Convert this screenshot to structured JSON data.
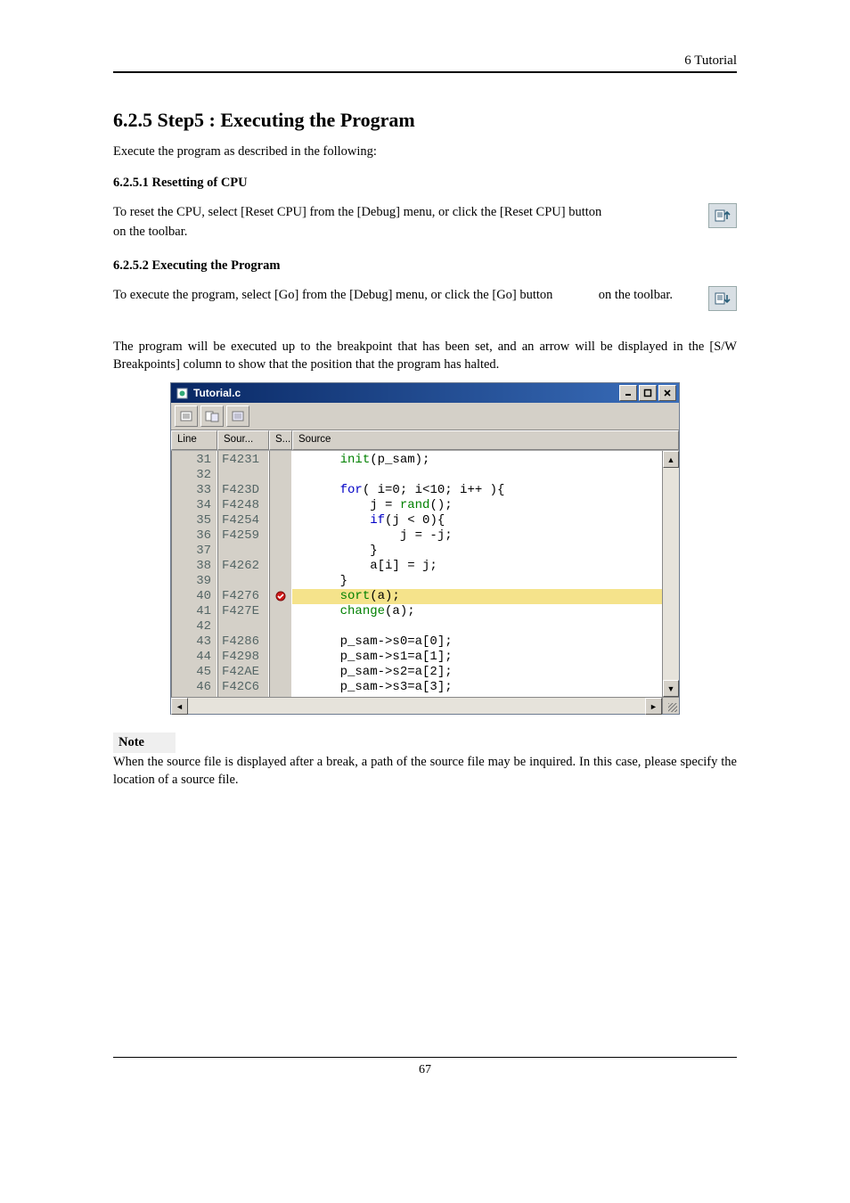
{
  "header": {
    "right": "6 Tutorial"
  },
  "section": {
    "title": "6.2.5 Step5 : Executing the Program"
  },
  "intro": "Execute the program as described in the following:",
  "sub1": {
    "title": "6.2.5.1 Resetting of CPU"
  },
  "reset_para_a": "To reset the CPU, select [Reset CPU] from the [Debug] menu, or click the [Reset CPU] button",
  "reset_para_b": "on the toolbar.",
  "sub2": {
    "title": "6.2.5.2 Executing the Program"
  },
  "exec_para_a": "To execute the program, select [Go] from the [Debug] menu, or click the [Go] button",
  "exec_para_b": "on the toolbar.",
  "exec_para2": "The program will be executed up to the breakpoint that has been set, and an arrow will be displayed in the [S/W Breakpoints] column to show that the position that the program has halted.",
  "codewin": {
    "title": "Tutorial.c",
    "cols": {
      "line": "Line",
      "sour": "Sour...",
      "bp": "S...",
      "src": "Source"
    },
    "rows": [
      {
        "line": "31",
        "addr": "F4231",
        "bp": "",
        "src": [
          [
            "    "
          ],
          [
            "green",
            "init"
          ],
          [
            "",
            "(p_sam);"
          ]
        ]
      },
      {
        "line": "32",
        "addr": "",
        "bp": "",
        "src": [
          [
            "",
            ""
          ]
        ]
      },
      {
        "line": "33",
        "addr": "F423D",
        "bp": "",
        "src": [
          [
            "    "
          ],
          [
            "blue",
            "for"
          ],
          [
            "",
            "( i=0; i<10; i++ ){"
          ]
        ]
      },
      {
        "line": "34",
        "addr": "F4248",
        "bp": "",
        "src": [
          [
            "        j = "
          ],
          [
            "green",
            "rand"
          ],
          [
            "",
            "();"
          ]
        ]
      },
      {
        "line": "35",
        "addr": "F4254",
        "bp": "",
        "src": [
          [
            "        "
          ],
          [
            "blue",
            "if"
          ],
          [
            "",
            "(j < 0){"
          ]
        ]
      },
      {
        "line": "36",
        "addr": "F4259",
        "bp": "",
        "src": [
          [
            "            j = -j;"
          ]
        ]
      },
      {
        "line": "37",
        "addr": "",
        "bp": "",
        "src": [
          [
            "        }"
          ]
        ]
      },
      {
        "line": "38",
        "addr": "F4262",
        "bp": "",
        "src": [
          [
            "        a[i] = j;"
          ]
        ]
      },
      {
        "line": "39",
        "addr": "",
        "bp": "",
        "src": [
          [
            "    }"
          ]
        ]
      },
      {
        "line": "40",
        "addr": "F4276",
        "bp": "●",
        "hl": true,
        "src": [
          [
            "    "
          ],
          [
            "green",
            "sort"
          ],
          [
            "",
            "(a);"
          ]
        ]
      },
      {
        "line": "41",
        "addr": "F427E",
        "bp": "",
        "src": [
          [
            "    "
          ],
          [
            "green",
            "change"
          ],
          [
            "",
            "(a);"
          ]
        ]
      },
      {
        "line": "42",
        "addr": "",
        "bp": "",
        "src": [
          [
            "",
            ""
          ]
        ]
      },
      {
        "line": "43",
        "addr": "F4286",
        "bp": "",
        "src": [
          [
            "    p_sam->s0=a[0];"
          ]
        ]
      },
      {
        "line": "44",
        "addr": "F4298",
        "bp": "",
        "src": [
          [
            "    p_sam->s1=a[1];"
          ]
        ]
      },
      {
        "line": "45",
        "addr": "F42AE",
        "bp": "",
        "src": [
          [
            "    p_sam->s2=a[2];"
          ]
        ]
      },
      {
        "line": "46",
        "addr": "F42C6",
        "bp": "",
        "src": [
          [
            "    p_sam->s3=a[3];"
          ]
        ]
      }
    ]
  },
  "note": {
    "label": "Note"
  },
  "note_para": "When the source file is displayed after a break, a path of the source file may be inquired. In this case, please specify the location of a source file.",
  "footer": {
    "pagenum": "67"
  }
}
